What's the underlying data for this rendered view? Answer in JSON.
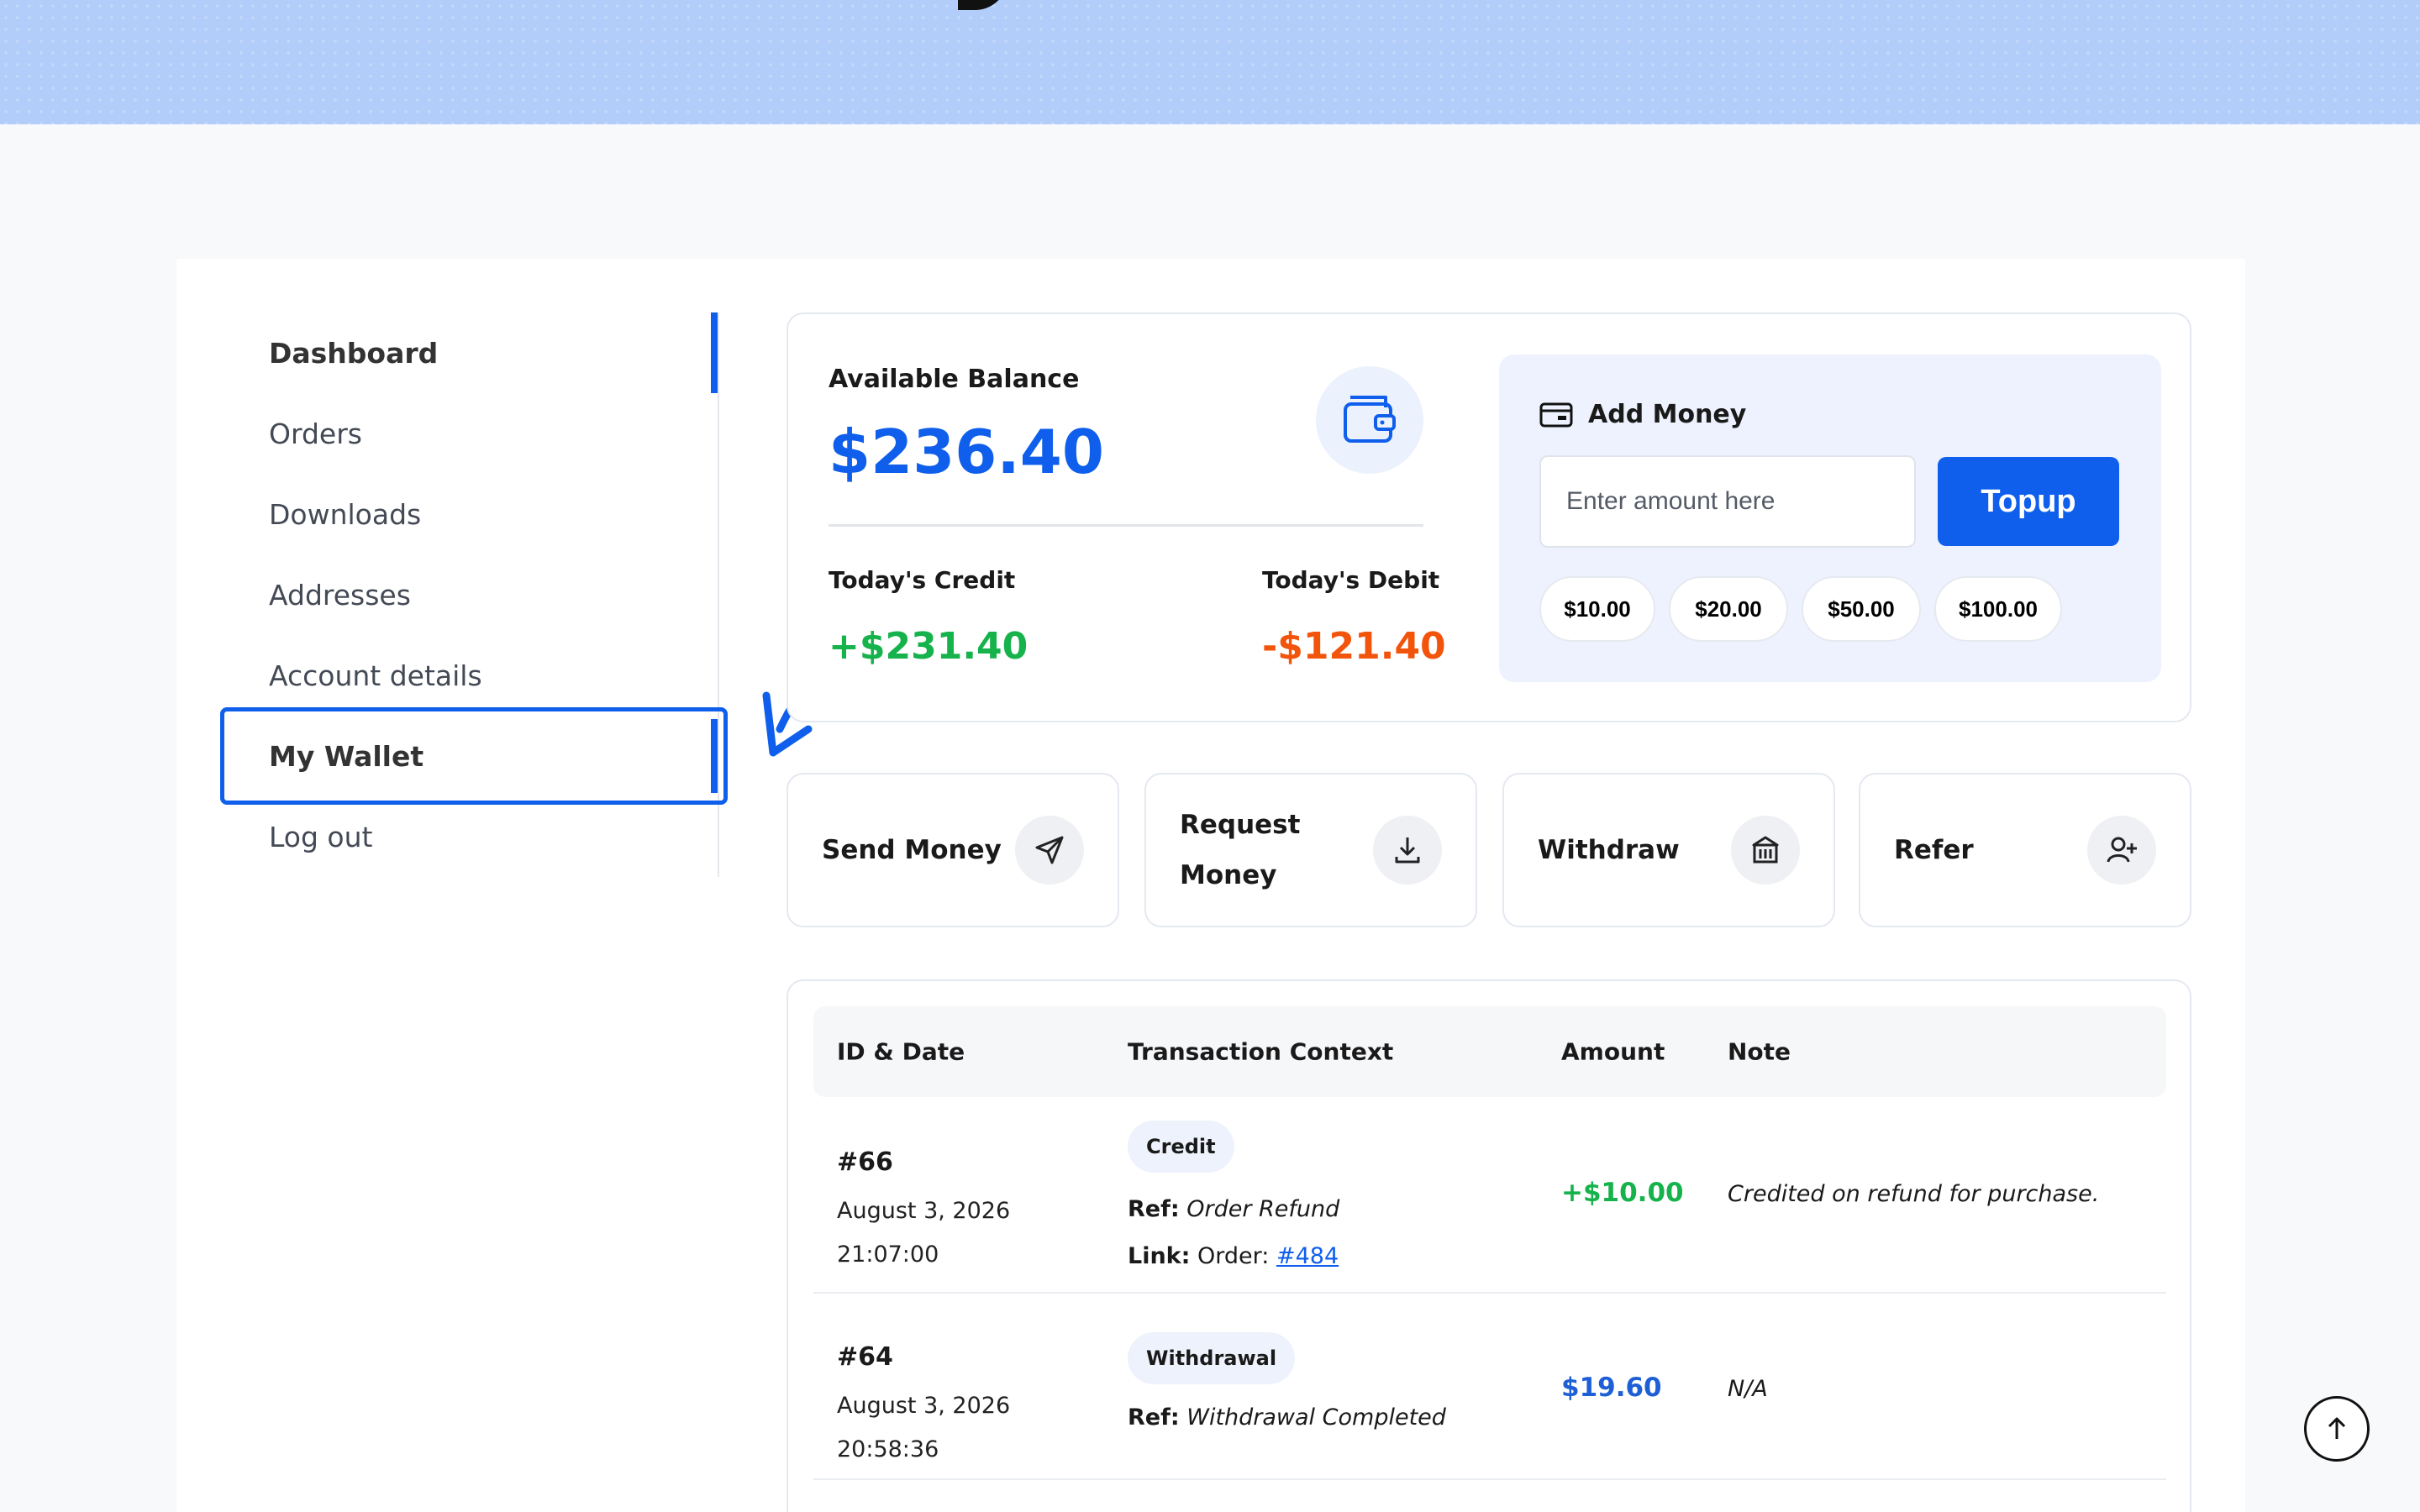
{
  "sidebar": {
    "items": [
      {
        "label": "Dashboard"
      },
      {
        "label": "Orders"
      },
      {
        "label": "Downloads"
      },
      {
        "label": "Addresses"
      },
      {
        "label": "Account details"
      },
      {
        "label": "My Wallet"
      },
      {
        "label": "Log out"
      }
    ]
  },
  "balance": {
    "label": "Available Balance",
    "value": "$236.40",
    "icon": "wallet-icon",
    "credit_label": "Today's Credit",
    "credit_value": "+$231.40",
    "debit_label": "Today's Debit",
    "debit_value": "-$121.40"
  },
  "add_money": {
    "title": "Add Money",
    "icon": "card-icon",
    "input_placeholder": "Enter amount here",
    "button_label": "Topup",
    "chips": [
      "$10.00",
      "$20.00",
      "$50.00",
      "$100.00"
    ]
  },
  "actions": [
    {
      "label": "Send Money",
      "icon": "send-icon"
    },
    {
      "label": "Request Money",
      "icon": "download-icon"
    },
    {
      "label": "Withdraw",
      "icon": "bank-icon"
    },
    {
      "label": "Refer",
      "icon": "user-plus-icon"
    }
  ],
  "transactions": {
    "headers": [
      "ID & Date",
      "Transaction Context",
      "Amount",
      "Note"
    ],
    "rows": [
      {
        "id": "#66",
        "date": "August 3, 2026",
        "time": "21:07:00",
        "type": "Credit",
        "ref_label": "Ref:",
        "ref_value": "Order Refund",
        "link_label": "Link:",
        "link_prefix": "Order:",
        "link_value": "#484",
        "amount": "+$10.00",
        "note": "Credited on refund for purchase."
      },
      {
        "id": "#64",
        "date": "August 3, 2026",
        "time": "20:58:36",
        "type": "Withdrawal",
        "ref_label": "Ref:",
        "ref_value": "Withdrawal Completed",
        "amount": "$19.60",
        "note": "N/A"
      }
    ]
  },
  "colors": {
    "accent": "#0f5fec",
    "credit": "#16b24b",
    "debit": "#f2540c",
    "hero": "#b2cdfa"
  }
}
